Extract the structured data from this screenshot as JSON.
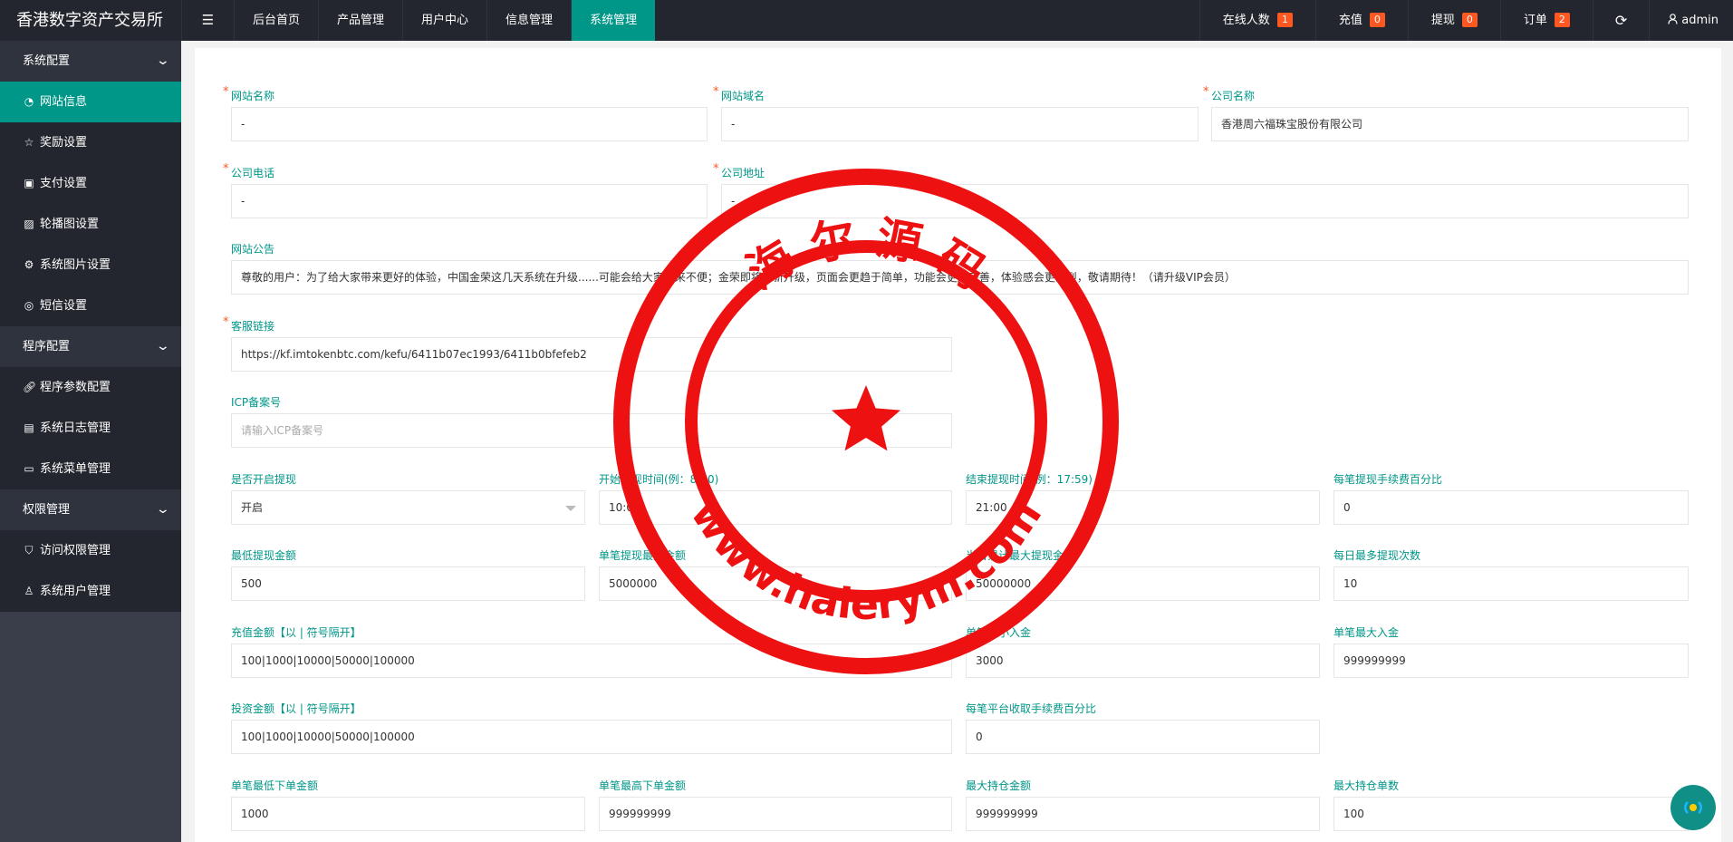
{
  "app": {
    "title": "香港数字资产交易所"
  },
  "topnav": {
    "toggle_icon": "menu-fold-icon",
    "items": [
      "后台首页",
      "产品管理",
      "用户中心",
      "信息管理",
      "系统管理"
    ],
    "active": "系统管理"
  },
  "topright": {
    "online": {
      "label": "在线人数",
      "count": "1"
    },
    "recharge": {
      "label": "充值",
      "count": "0"
    },
    "withdraw": {
      "label": "提现",
      "count": "0"
    },
    "orders": {
      "label": "订单",
      "count": "2"
    },
    "refresh_icon": "refresh-icon",
    "user": "admin"
  },
  "sidebar": {
    "groups": [
      {
        "title": "系统配置",
        "items": [
          "网站信息",
          "奖励设置",
          "支付设置",
          "轮播图设置",
          "系统图片设置",
          "短信设置"
        ]
      },
      {
        "title": "程序配置",
        "items": [
          "程序参数配置",
          "系统日志管理",
          "系统菜单管理"
        ]
      },
      {
        "title": "权限管理",
        "items": [
          "访问权限管理",
          "系统用户管理"
        ]
      }
    ],
    "active_item": "网站信息"
  },
  "form": {
    "site_name": {
      "label": "网站名称",
      "value": "-"
    },
    "site_domain": {
      "label": "网站域名",
      "value": "-"
    },
    "company_name": {
      "label": "公司名称",
      "value": "香港周六福珠宝股份有限公司"
    },
    "company_phone": {
      "label": "公司电话",
      "value": "-"
    },
    "company_address": {
      "label": "公司地址",
      "value": "-"
    },
    "notice": {
      "label": "网站公告",
      "value": "尊敬的用户：为了给大家带来更好的体验，中国金荣这几天系统在升级......可能会给大家带来不便；金荣即将全新升级，页面会更趋于简单，功能会更加完善，体验感会更强烈，敬请期待！（请升级VIP会员）"
    },
    "service_link": {
      "label": "客服链接",
      "value": "https://kf.imtokenbtc.com/kefu/6411b07ec1993/6411b0bfefeb2"
    },
    "icp": {
      "label": "ICP备案号",
      "placeholder": "请输入ICP备案号"
    },
    "withdraw_enabled": {
      "label": "是否开启提现",
      "value": "开启"
    },
    "withdraw_start": {
      "label": "开始提现时间(例：8:00)",
      "value": "10:00"
    },
    "withdraw_end": {
      "label": "结束提现时间(例：17:59)",
      "value": "21:00"
    },
    "withdraw_fee_pct": {
      "label": "每笔提现手续费百分比",
      "value": "0"
    },
    "min_withdraw": {
      "label": "最低提现金额",
      "value": "500"
    },
    "max_single_withdraw": {
      "label": "单笔提现最大金额",
      "value": "5000000"
    },
    "daily_total_withdraw": {
      "label": "当日累计最大提现金额",
      "value": "50000000"
    },
    "daily_withdraw_count": {
      "label": "每日最多提现次数",
      "value": "10"
    },
    "recharge_amounts": {
      "label": "充值金额【以 | 符号隔开】",
      "value": "100|1000|10000|50000|100000"
    },
    "min_deposit": {
      "label": "单笔最小入金",
      "value": "3000"
    },
    "max_deposit": {
      "label": "单笔最大入金",
      "value": "999999999"
    },
    "invest_amounts": {
      "label": "投资金额【以 | 符号隔开】",
      "value": "100|1000|10000|50000|100000"
    },
    "platform_fee_pct": {
      "label": "每笔平台收取手续费百分比",
      "value": "0"
    },
    "min_order": {
      "label": "单笔最低下单金额",
      "value": "1000"
    },
    "max_order": {
      "label": "单笔最高下单金额",
      "value": "999999999"
    },
    "max_position_amount": {
      "label": "最大持仓金额",
      "value": "999999999"
    },
    "max_position_count": {
      "label": "最大持仓单数",
      "value": "100"
    }
  },
  "stamp": {
    "text_top": "海 尔 源 码",
    "text_bottom": "www.haierym.com",
    "color": "#ee1111"
  },
  "colors": {
    "accent": "#009688",
    "badge": "#ff5722",
    "topbar": "#23262e",
    "sidebar": "#3a3e4a"
  }
}
